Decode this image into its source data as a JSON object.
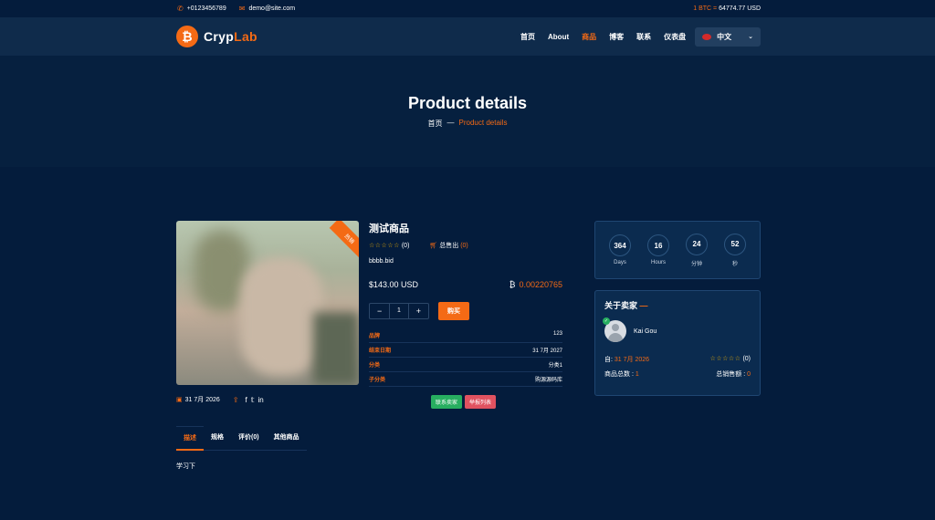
{
  "topbar": {
    "phone": "+0123456789",
    "email": "demo@site.com",
    "btc_label": "1 BTC =",
    "btc_value": "64774.77 USD"
  },
  "brand": {
    "name_a": "Cryp",
    "name_b": "Lab",
    "mark": "₿"
  },
  "nav": {
    "items": [
      "首页",
      "About",
      "商品",
      "博客",
      "联系",
      "仪表盘"
    ],
    "active_index": 2,
    "lang": "中文"
  },
  "banner": {
    "title": "Product details",
    "crumb_home": "首页",
    "crumb_sep": "—",
    "crumb_current": "Product details"
  },
  "product": {
    "badge": "热销",
    "name": "测试商品",
    "stars": "☆☆☆☆☆",
    "rating_count": "(0)",
    "sold_label": "总售出",
    "sold_count": "(0)",
    "tag": "bbbb.bid",
    "price_usd": "$143.00 USD",
    "price_btc": "0.00220765",
    "qty": "1",
    "buy_label": "购买",
    "date": "31 7月 2026",
    "specs": [
      {
        "k": "品牌",
        "v": "123"
      },
      {
        "k": "结束日期",
        "v": "31 7月 2027"
      },
      {
        "k": "分类",
        "v": "分类1"
      },
      {
        "k": "子分类",
        "v": "购源源码库"
      }
    ],
    "contact_label": "联系卖家",
    "report_label": "举报列表"
  },
  "timer": [
    {
      "v": "364",
      "l": "Days"
    },
    {
      "v": "16",
      "l": "Hours"
    },
    {
      "v": "24",
      "l": "分钟"
    },
    {
      "v": "52",
      "l": "秒"
    }
  ],
  "seller": {
    "heading": "关于卖家",
    "name": "Kai Gou",
    "since_label": "自:",
    "since": "31 7月 2026",
    "stars": "☆☆☆☆☆",
    "rating_count": "(0)",
    "total_label": "商品总数 :",
    "total": "1",
    "sales_label": "总销售额 :",
    "sales": "0"
  },
  "tabs": [
    "描述",
    "规格",
    "评价(0)",
    "其他商品"
  ],
  "description": "学习下",
  "colors": {
    "accent": "#f46a15",
    "bg": "#041c3c"
  }
}
